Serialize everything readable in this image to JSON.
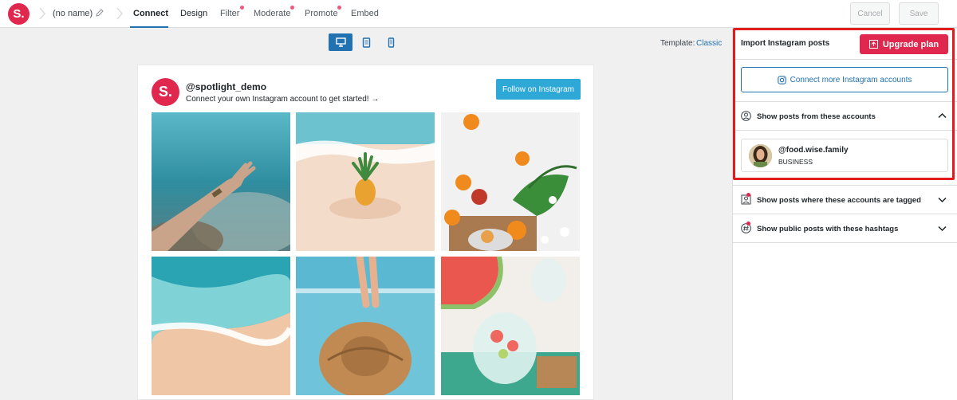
{
  "app": {
    "logo_letter": "S.",
    "feed_name": "(no name)"
  },
  "nav": {
    "tabs": [
      {
        "label": "Connect"
      },
      {
        "label": "Design"
      },
      {
        "label": "Filter"
      },
      {
        "label": "Moderate"
      },
      {
        "label": "Promote"
      },
      {
        "label": "Embed"
      }
    ],
    "cancel_label": "Cancel",
    "save_label": "Save"
  },
  "preview": {
    "template_label": "Template:",
    "template_value": "Classic",
    "devices": [
      "desktop-icon",
      "tablet-icon",
      "phone-icon"
    ],
    "profile": {
      "avatar_letter": "S.",
      "handle": "@spotlight_demo",
      "bio": "Connect your own Instagram account to get started! →",
      "follow_label": "Follow on Instagram"
    }
  },
  "sidebar": {
    "title": "Import Instagram posts",
    "upgrade_label": "Upgrade plan",
    "connect_more_label": "Connect more Instagram accounts",
    "sections": [
      {
        "title": "Show posts from these accounts"
      },
      {
        "title": "Show posts where these accounts are tagged"
      },
      {
        "title": "Show public posts with these hashtags"
      }
    ],
    "account": {
      "name": "@food.wise.family",
      "type": "BUSINESS"
    }
  },
  "colors": {
    "brand": "#e0284f",
    "accent": "#2271b1",
    "follow": "#2ea8d7",
    "highlight": "#e21c1c"
  }
}
